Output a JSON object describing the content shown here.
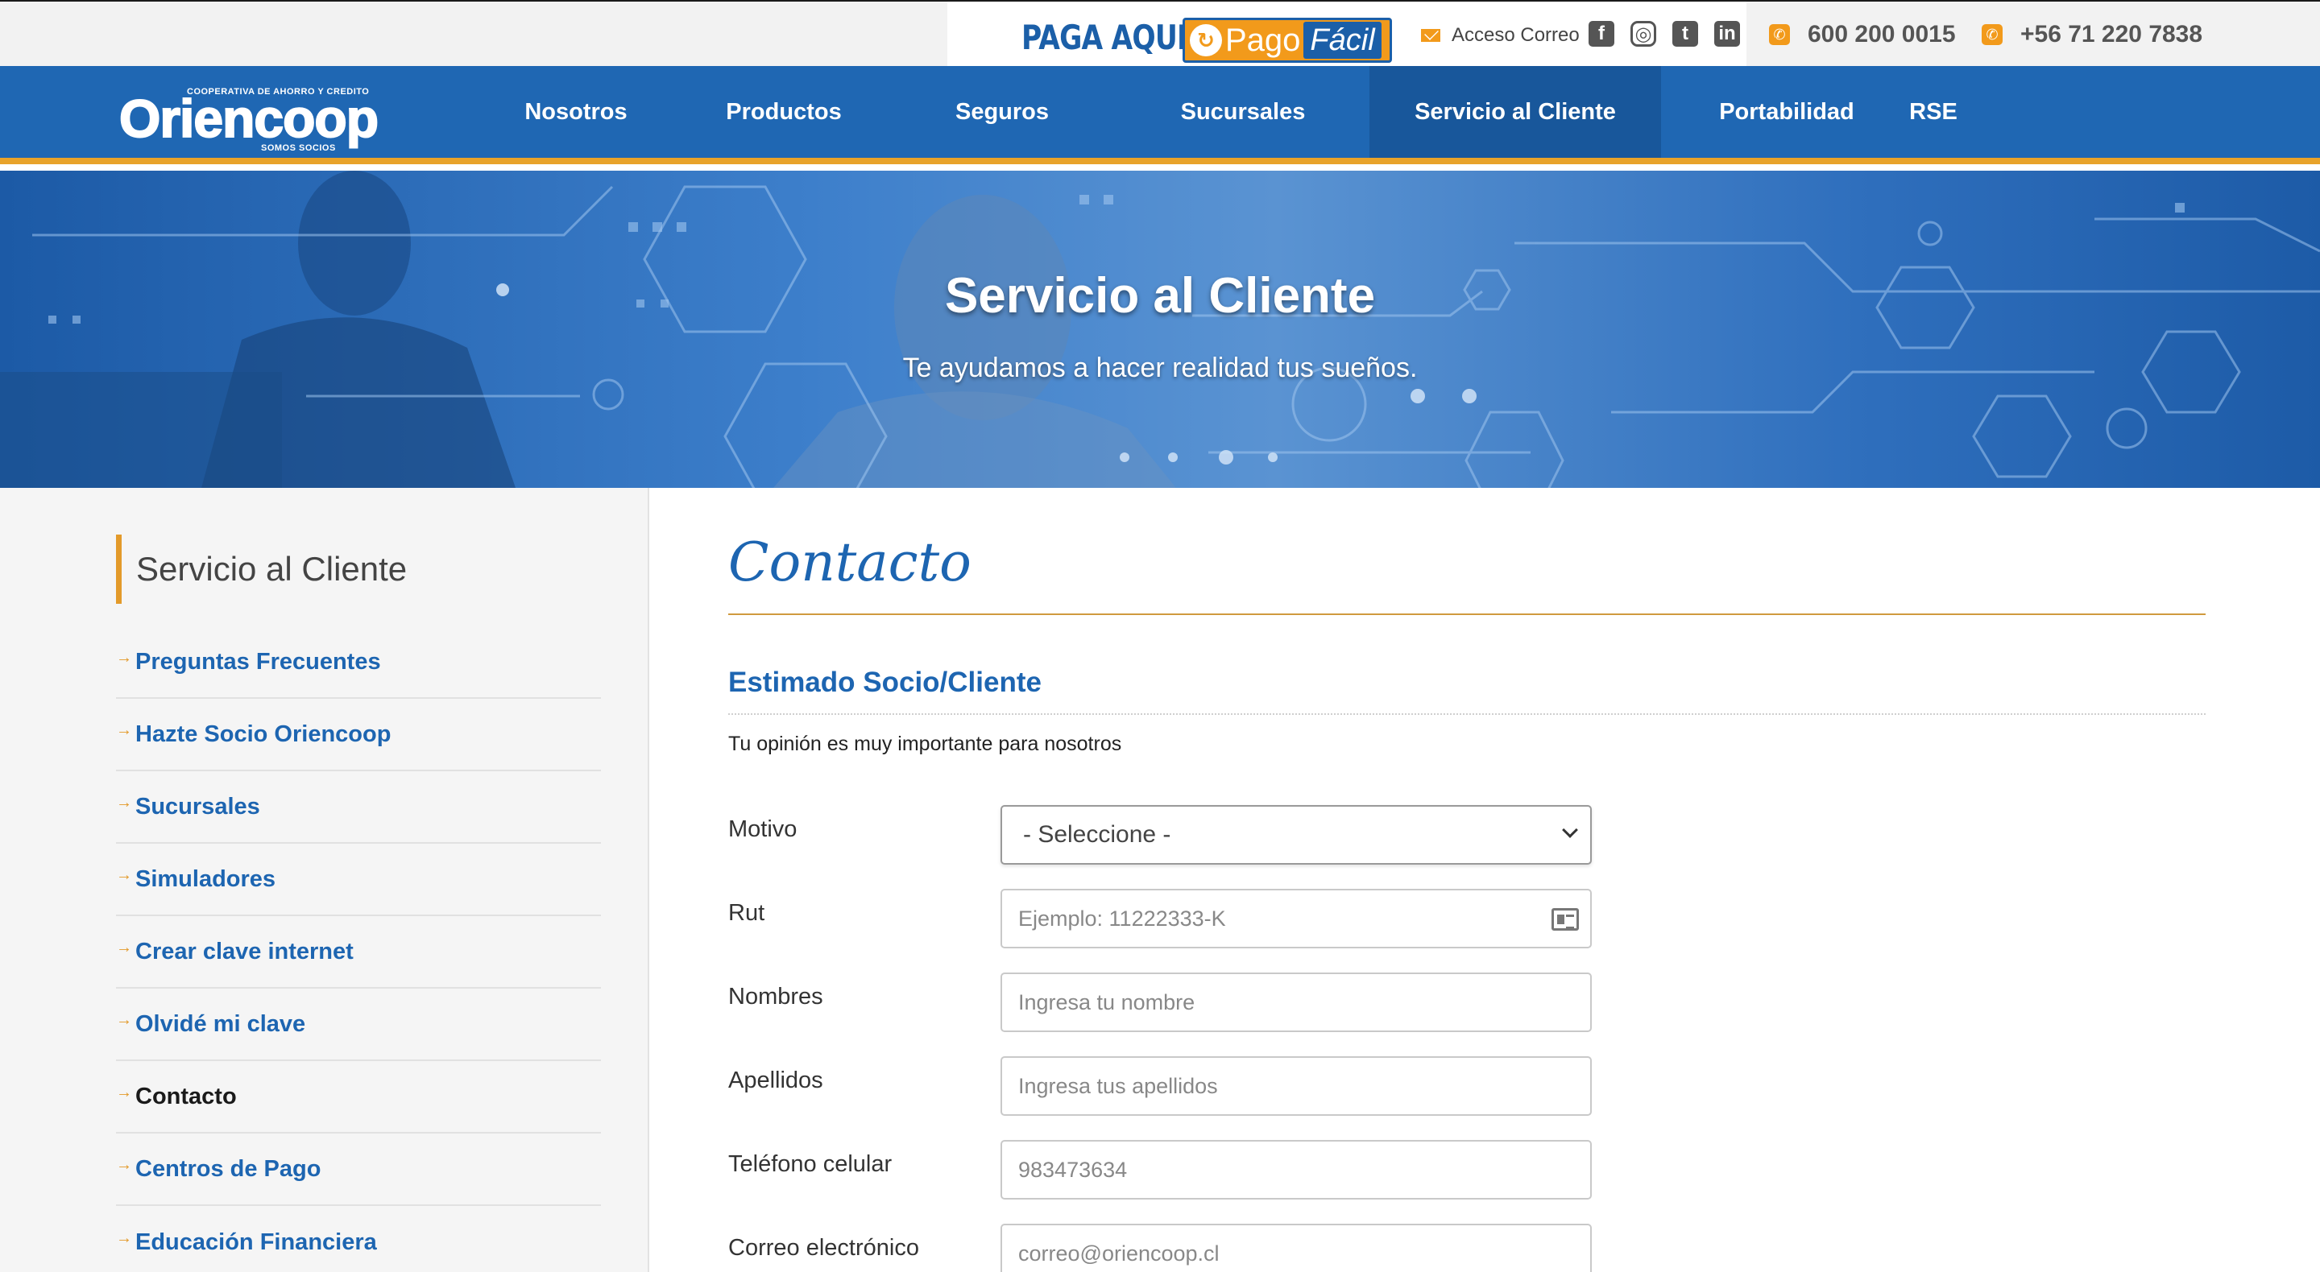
{
  "colors": {
    "brand_blue": "#1f67b3",
    "accent_orange": "#e8a32a",
    "link_blue": "#1d65b1"
  },
  "topbar": {
    "paga_aqui": "PAGA AQUI",
    "pagofacil": {
      "pago": "Pago",
      "facil": "Fácil"
    },
    "acceso_correo": "Acceso Correo",
    "social_icons": [
      "facebook-icon",
      "instagram-icon",
      "twitter-icon",
      "linkedin-icon"
    ],
    "phone1": "600 200 0015",
    "phone2": "+56 71 220 7838"
  },
  "logo": {
    "tagline": "COOPERATIVA DE AHORRO Y CREDITO",
    "brand": "Oriencoop",
    "sub": "SOMOS SOCIOS"
  },
  "nav": {
    "items": [
      {
        "label": "Nosotros"
      },
      {
        "label": "Productos"
      },
      {
        "label": "Seguros"
      },
      {
        "label": "Sucursales"
      },
      {
        "label": "Servicio al Cliente",
        "active": true
      },
      {
        "label": "Portabilidad"
      },
      {
        "label": "RSE"
      }
    ]
  },
  "hero": {
    "title": "Servicio al Cliente",
    "subtitle": "Te ayudamos a hacer realidad tus sueños."
  },
  "sidebar": {
    "title": "Servicio al Cliente",
    "items": [
      {
        "label": "Preguntas Frecuentes"
      },
      {
        "label": "Hazte Socio Oriencoop"
      },
      {
        "label": "Sucursales"
      },
      {
        "label": "Simuladores"
      },
      {
        "label": "Crear clave internet"
      },
      {
        "label": "Olvidé mi clave"
      },
      {
        "label": "Contacto",
        "current": true
      },
      {
        "label": "Centros de Pago"
      },
      {
        "label": "Educación Financiera"
      }
    ]
  },
  "main": {
    "heading": "Contacto",
    "section_title": "Estimado Socio/Cliente",
    "intro": "Tu opinión es muy importante para nosotros",
    "form": {
      "motivo": {
        "label": "Motivo",
        "selected": "- Seleccione -"
      },
      "rut": {
        "label": "Rut",
        "placeholder": "Ejemplo: 11222333-K"
      },
      "nombres": {
        "label": "Nombres",
        "placeholder": "Ingresa tu nombre"
      },
      "apellidos": {
        "label": "Apellidos",
        "placeholder": "Ingresa tus apellidos"
      },
      "telefono": {
        "label": "Teléfono celular",
        "placeholder": "983473634"
      },
      "correo": {
        "label": "Correo electrónico",
        "placeholder": "correo@oriencoop.cl"
      }
    }
  }
}
